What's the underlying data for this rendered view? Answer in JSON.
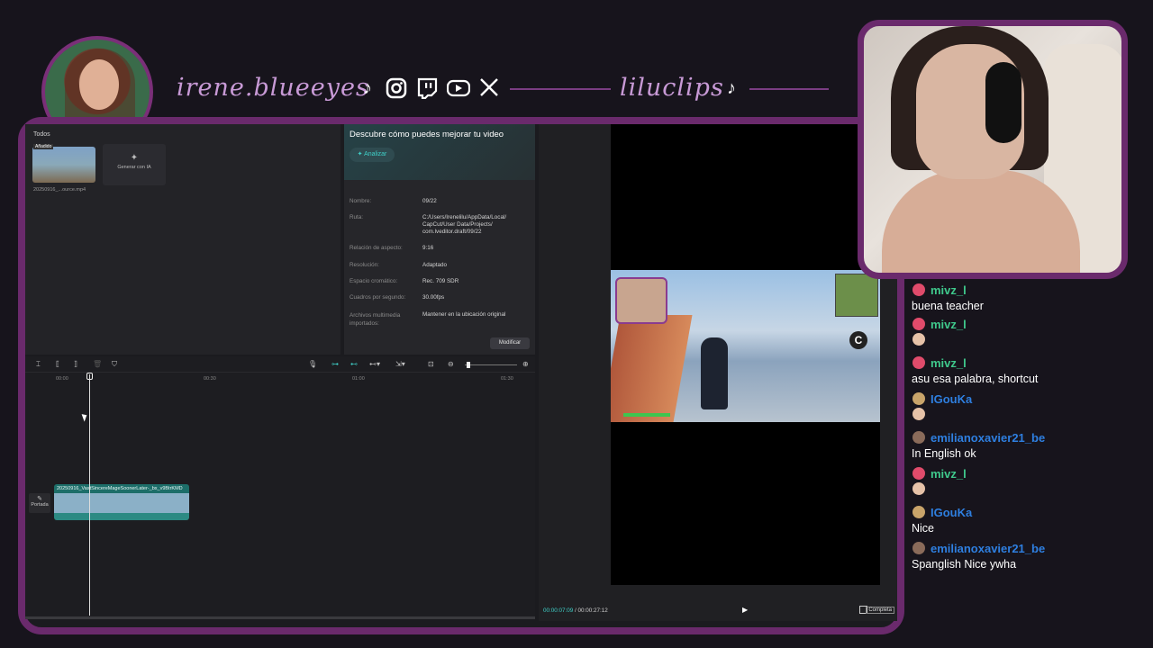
{
  "header": {
    "handle": "irene.blueeyes",
    "handle2": "liluclips",
    "socials": [
      "tiktok-icon",
      "instagram-icon",
      "twitch-icon",
      "youtube-icon",
      "x-icon"
    ]
  },
  "media_panel": {
    "filter_label": "Todos",
    "thumb_tag": "Añadido",
    "thumb_name": "20250916_...ource.mp4",
    "generate_label": "Generar con IA"
  },
  "details": {
    "title": "Descubre cómo puedes mejorar tu video",
    "analyze_label": "Analizar",
    "rows": [
      {
        "key": "Nombre:",
        "value": "09/22"
      },
      {
        "key": "Ruta:",
        "value": "C:/Users/Irenelilu/AppData/Local/ CapCut/User Data/Projects/ com.lveditor.draft/09/22"
      },
      {
        "key": "Relación de aspecto:",
        "value": "9:16"
      },
      {
        "key": "Resolución:",
        "value": "Adaptado"
      },
      {
        "key": "Espacio cromático:",
        "value": "Rec. 709 SDR"
      },
      {
        "key": "Cuadros por segundo:",
        "value": "30.00fps"
      },
      {
        "key": "Archivos multimedia importados:",
        "value": "Mantener en la ubicación original"
      }
    ],
    "modify_label": "Modificar"
  },
  "timeline": {
    "ruler": [
      "00:00",
      "00:30",
      "01:00",
      "01:30"
    ],
    "clip_name": "20250916_VastSincereMageSoonerLater-_bx_v9BtrKMD",
    "cover_label": "Portada"
  },
  "player": {
    "current_time": "00:00:07:09",
    "total_time": "00:00:27:12",
    "fullscreen_label": "Completa",
    "game_cam_label": "IRENEBLUEEYES"
  },
  "chat": [
    {
      "user": "mivz_l",
      "text": "buena teacher",
      "color": "#3fc98c",
      "icon": "#e04b6b"
    },
    {
      "user": "mivz_l",
      "text": "",
      "color": "#3fc98c",
      "icon": "#e04b6b",
      "emote": true
    },
    {
      "user": "mivz_l",
      "text": "asu esa palabra, shortcut",
      "color": "#3fc98c",
      "icon": "#e04b6b"
    },
    {
      "user": "IGouKa",
      "text": "",
      "color": "#2e7fe0",
      "icon": "#c9a46a",
      "emote": true
    },
    {
      "user": "emilianoxavier21_be",
      "text": "In English ok",
      "color": "#2e7fe0",
      "icon": "#8a6b5a"
    },
    {
      "user": "mivz_l",
      "text": "",
      "color": "#3fc98c",
      "icon": "#e04b6b",
      "emote": true
    },
    {
      "user": "IGouKa",
      "text": "Nice",
      "color": "#2e7fe0",
      "icon": "#c9a46a"
    },
    {
      "user": "emilianoxavier21_be",
      "text": "Spanglish Nice ywha",
      "color": "#2e7fe0",
      "icon": "#8a6b5a"
    }
  ]
}
